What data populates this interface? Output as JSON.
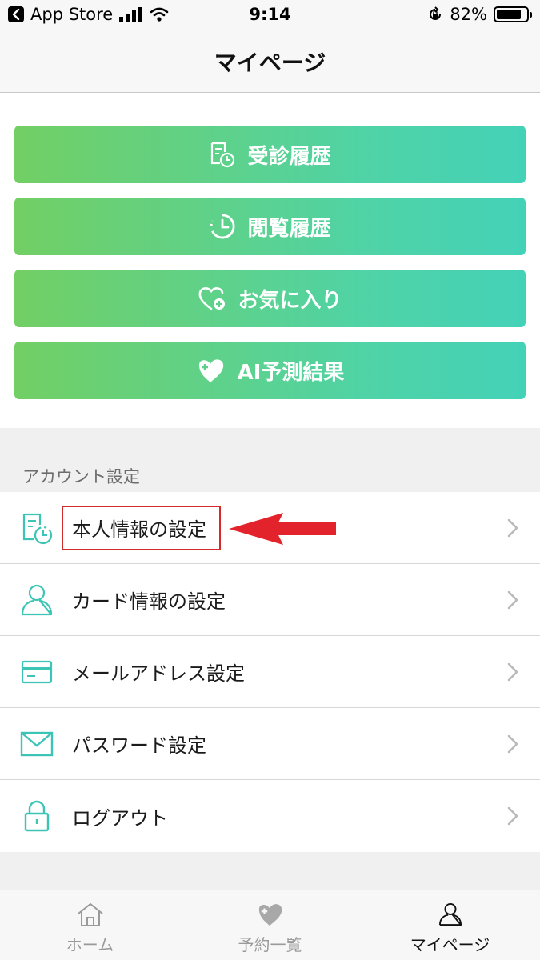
{
  "status_bar": {
    "back_app": "App Store",
    "time": "9:14",
    "battery": "82%",
    "battery_level": 0.82
  },
  "nav": {
    "title": "マイページ"
  },
  "menu_buttons": [
    {
      "label": "受診履歴",
      "icon": "document-clock-icon"
    },
    {
      "label": "閲覧履歴",
      "icon": "clock-icon"
    },
    {
      "label": "お気に入り",
      "icon": "heart-plus-icon"
    },
    {
      "label": "AI予測結果",
      "icon": "ai-heart-icon"
    }
  ],
  "account_section": {
    "header": "アカウント設定",
    "items": [
      {
        "label": "本人情報の設定",
        "icon": "document-clock-icon"
      },
      {
        "label": "カード情報の設定",
        "icon": "person-icon"
      },
      {
        "label": "メールアドレス設定",
        "icon": "card-icon"
      },
      {
        "label": "パスワード設定",
        "icon": "mail-icon"
      },
      {
        "label": "ログアウト",
        "icon": "lock-icon"
      }
    ]
  },
  "tabs": [
    {
      "label": "ホーム",
      "icon": "home-icon",
      "active": false
    },
    {
      "label": "予約一覧",
      "icon": "ai-heart-icon",
      "active": false
    },
    {
      "label": "マイページ",
      "icon": "person-icon",
      "active": true
    }
  ],
  "colors": {
    "accent_start": "#72cf64",
    "accent_end": "#44d2b7",
    "icon_teal": "#3cc4b4",
    "annotation_red": "#e3232b"
  }
}
